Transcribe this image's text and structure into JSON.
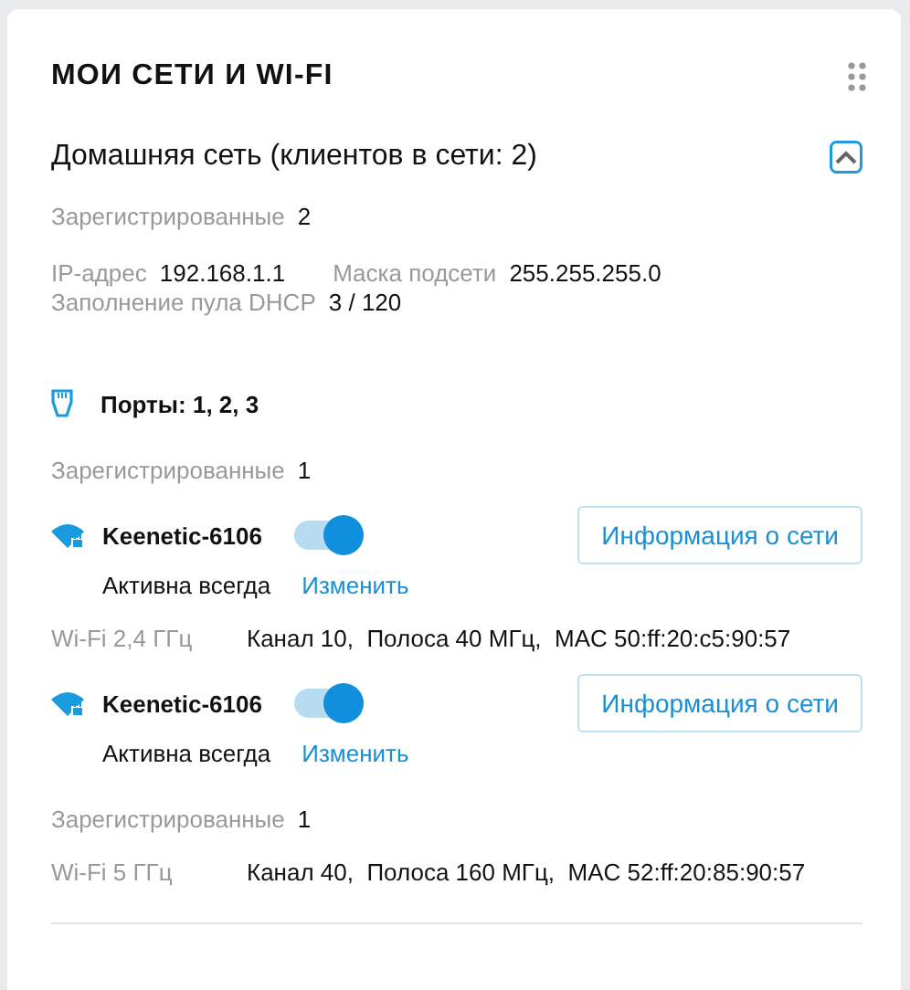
{
  "title": "МОИ СЕТИ И WI-FI",
  "network": {
    "name": "Домашняя сеть (клиентов в сети: 2)",
    "expanded": true,
    "registered": {
      "label": "Зарегистрированные",
      "value": "2"
    },
    "ip_label": "IP-адрес",
    "ip": "192.168.1.1",
    "mask_label": "Маска подсети",
    "mask": "255.255.255.0",
    "dhcp_label": "Заполнение пула DHCP",
    "dhcp": "3 / 120"
  },
  "items": [
    {
      "kind": "ports",
      "label": "Порты: 1, 2, 3"
    },
    {
      "kind": "registered",
      "label": "Зарегистрированные",
      "value": "1"
    },
    {
      "kind": "wifi",
      "ssid": "Keenetic-6106",
      "on": true,
      "button": "Информация о сети",
      "schedule": "Активна всегда",
      "link": "Изменить"
    },
    {
      "kind": "band",
      "label": "Wi-Fi 2,4 ГГц",
      "details": "Канал 10,  Полоса 40 МГц,  MAC 50:ff:20:c5:90:57"
    },
    {
      "kind": "wifi",
      "ssid": "Keenetic-6106",
      "on": true,
      "button": "Информация о сети",
      "schedule": "Активна всегда",
      "link": "Изменить"
    },
    {
      "kind": "registered",
      "label": "Зарегистрированные",
      "value": "1"
    },
    {
      "kind": "band",
      "label": "Wi-Fi 5 ГГц",
      "details": "Канал 40,  Полоса 160 МГц,  MAC 52:ff:20:85:90:57"
    }
  ]
}
